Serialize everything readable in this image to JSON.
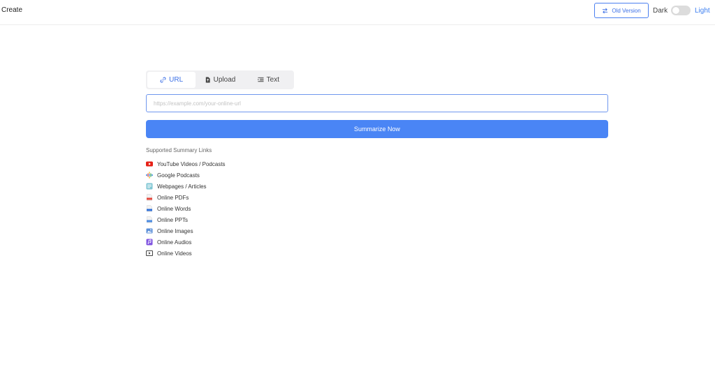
{
  "header": {
    "title": "Create",
    "old_version_label": "Old Version",
    "dark_label": "Dark",
    "light_label": "Light"
  },
  "tabs": [
    {
      "label": "URL",
      "icon": "link-icon",
      "active": true
    },
    {
      "label": "Upload",
      "icon": "file-upload-icon",
      "active": false
    },
    {
      "label": "Text",
      "icon": "text-align-icon",
      "active": false
    }
  ],
  "input": {
    "placeholder": "https://example.com/your-online-url",
    "value": ""
  },
  "summarize_label": "Summarize Now",
  "supported": {
    "heading": "Supported Summary Links",
    "items": [
      {
        "label": "YouTube Videos / Podcasts",
        "icon": "youtube-icon"
      },
      {
        "label": "Google Podcasts",
        "icon": "google-podcasts-icon"
      },
      {
        "label": "Webpages / Articles",
        "icon": "webpage-icon"
      },
      {
        "label": "Online PDFs",
        "icon": "pdf-icon"
      },
      {
        "label": "Online Words",
        "icon": "word-doc-icon"
      },
      {
        "label": "Online PPTs",
        "icon": "ppt-icon"
      },
      {
        "label": "Online Images",
        "icon": "image-icon"
      },
      {
        "label": "Online Audios",
        "icon": "audio-icon"
      },
      {
        "label": "Online Videos",
        "icon": "video-icon"
      }
    ]
  },
  "colors": {
    "accent": "#4a85f5",
    "accent_text": "#3b6fe6",
    "toggle_off": "#dcdcdc"
  }
}
